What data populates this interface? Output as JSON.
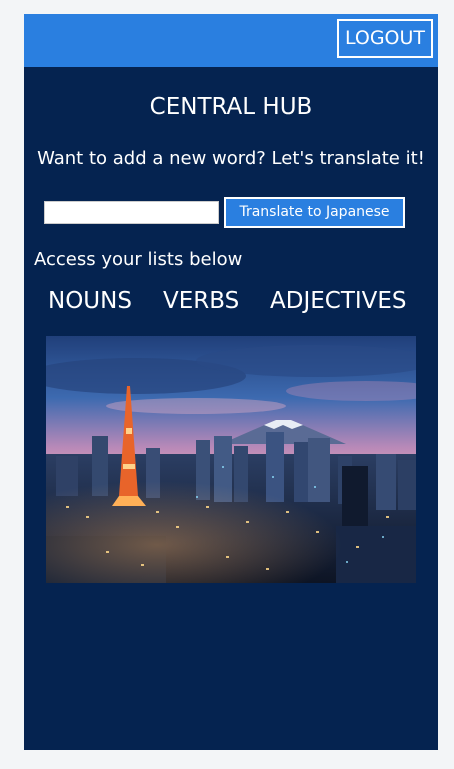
{
  "header": {
    "logout_label": "LOGOUT"
  },
  "main": {
    "title": "CENTRAL HUB",
    "prompt": "Want to add a new word? Let's translate it!",
    "input_value": "",
    "translate_label": "Translate to Japanese",
    "access_text": "Access your lists below",
    "lists": [
      "NOUNS",
      "VERBS",
      "ADJECTIVES"
    ]
  },
  "colors": {
    "background": "#052350",
    "header": "#2a7fe0",
    "button": "#2a7fe0",
    "text": "#ffffff"
  },
  "image": {
    "subject": "tokyo-skyline-photo"
  }
}
